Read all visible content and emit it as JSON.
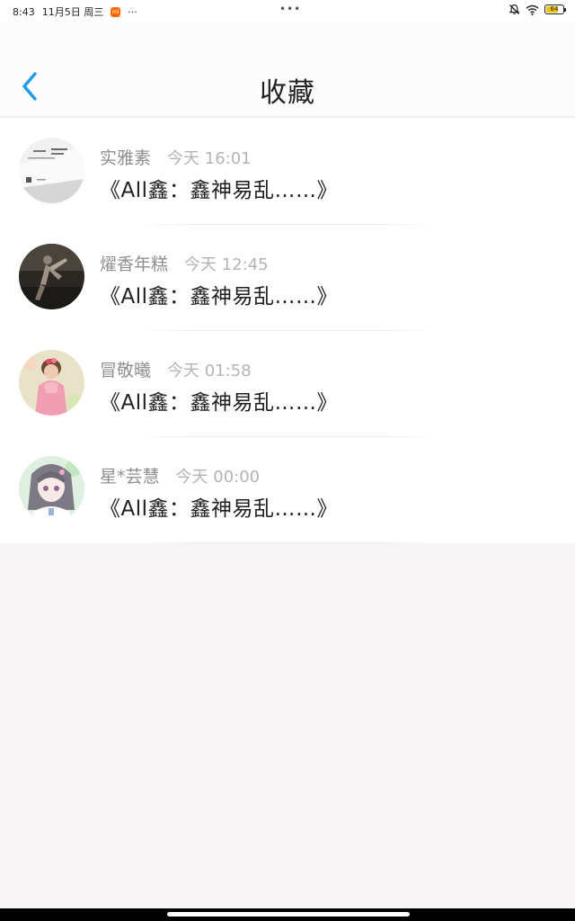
{
  "status_bar": {
    "time": "8:43",
    "date": "11月5日 周三",
    "app_badge": "mi",
    "more_dots": "···",
    "center_dots": "•••",
    "icons": [
      "bell-muted-icon",
      "wifi-icon"
    ],
    "battery_level": "64"
  },
  "header": {
    "back_icon": "chevron-left-icon",
    "title": "收藏",
    "accent_color": "#1e9be9"
  },
  "favorites": [
    {
      "author": "实雅素",
      "time": "今天 16:01",
      "title": "《All鑫：鑫神易乱……》",
      "avatar": "book-photo-avatar"
    },
    {
      "author": "燿香年糕",
      "time": "今天 12:45",
      "title": "《All鑫：鑫神易乱……》",
      "avatar": "dark-figure-avatar"
    },
    {
      "author": "冒敬曦",
      "time": "今天 01:58",
      "title": "《All鑫：鑫神易乱……》",
      "avatar": "pink-girl-avatar"
    },
    {
      "author": "星*芸慧",
      "time": "今天 00:00",
      "title": "《All鑫：鑫神易乱……》",
      "avatar": "anime-girl-avatar"
    }
  ]
}
